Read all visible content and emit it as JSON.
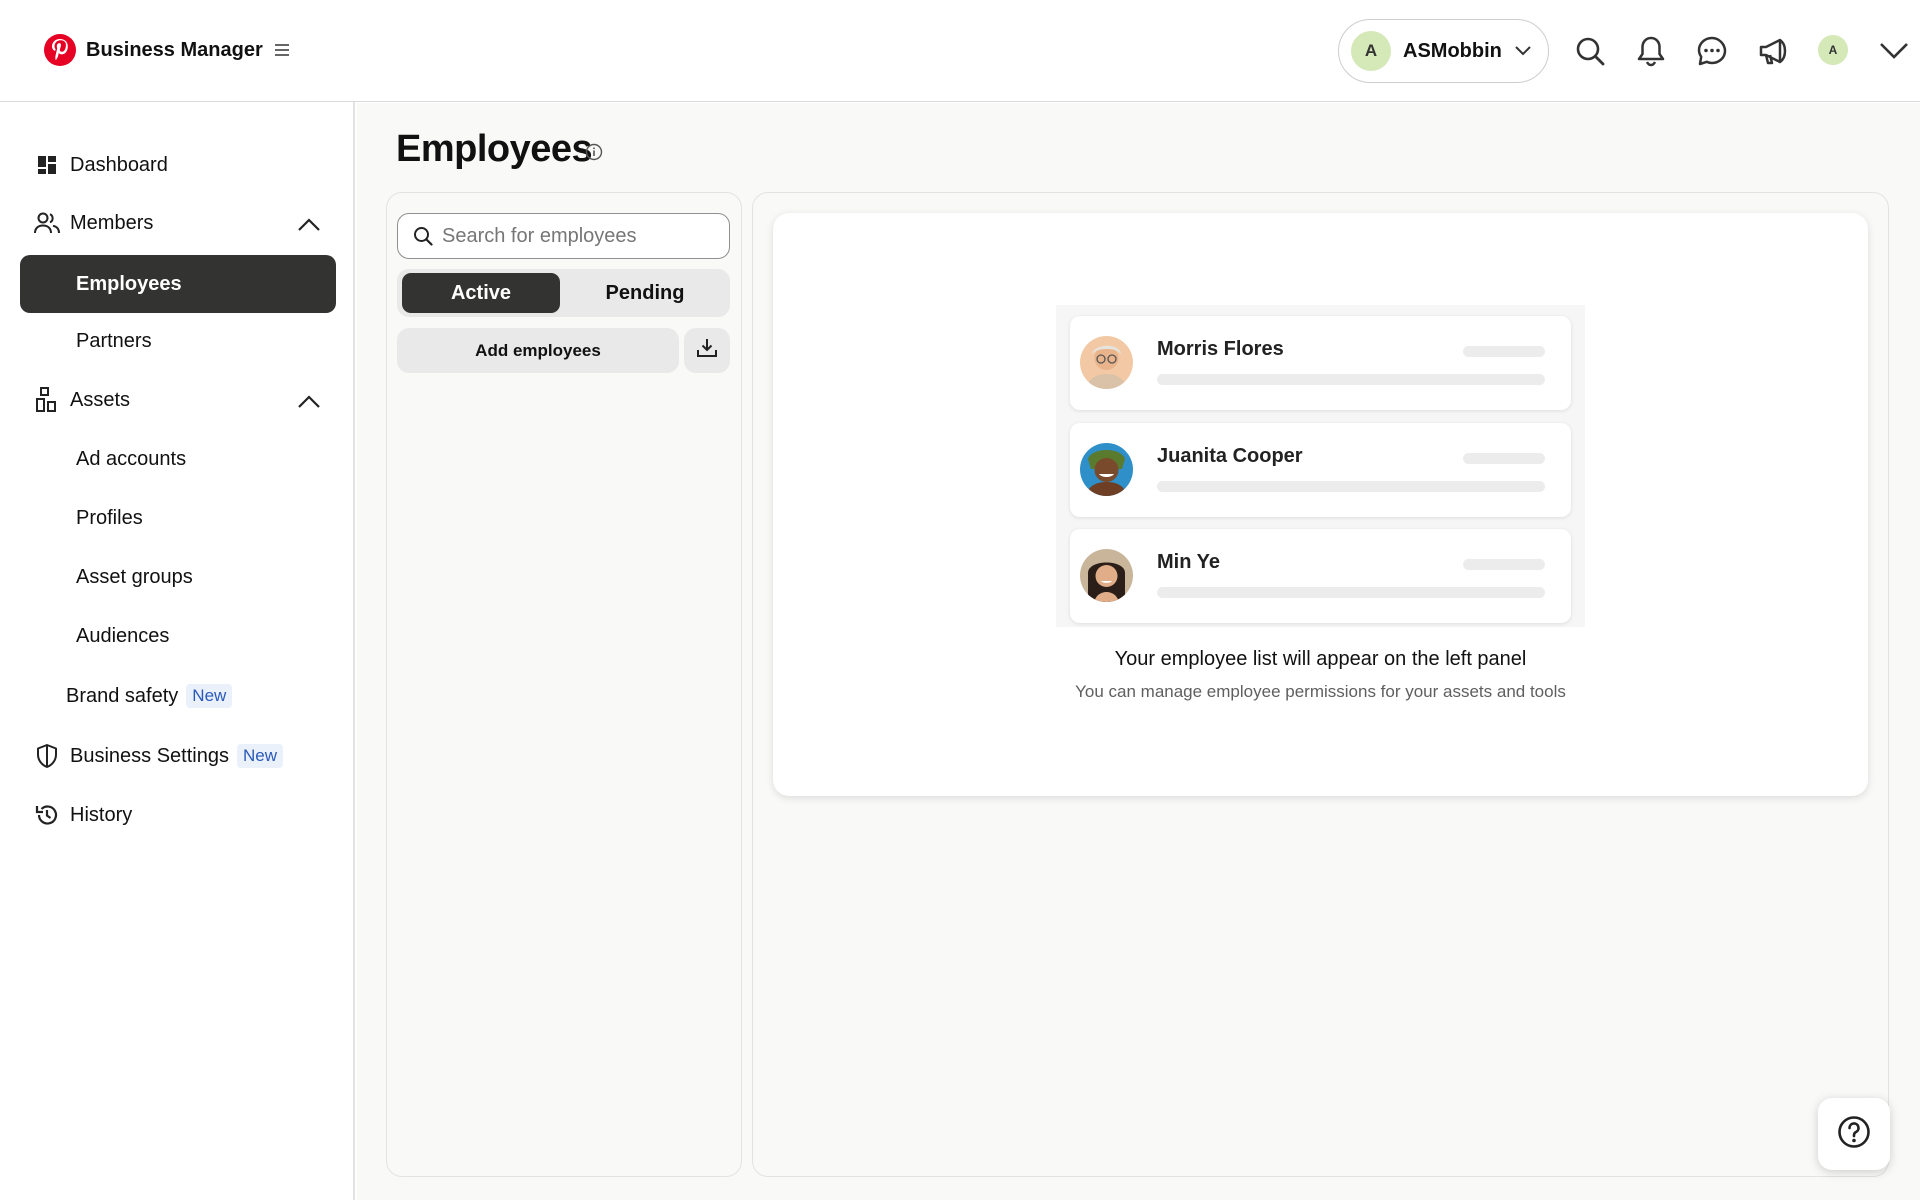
{
  "header": {
    "app_title": "Business Manager",
    "account_initial": "A",
    "account_name": "ASMobbin",
    "user_initial": "A"
  },
  "sidebar": {
    "items": [
      {
        "label": "Dashboard",
        "icon": "dashboard-icon"
      },
      {
        "label": "Members",
        "icon": "members-icon",
        "expanded": true
      },
      {
        "label": "Employees",
        "active": true
      },
      {
        "label": "Partners"
      },
      {
        "label": "Assets",
        "icon": "assets-icon",
        "expanded": true
      },
      {
        "label": "Ad accounts"
      },
      {
        "label": "Profiles"
      },
      {
        "label": "Asset groups"
      },
      {
        "label": "Audiences"
      },
      {
        "label": "Brand safety",
        "badge": "New"
      },
      {
        "label": "Business Settings",
        "icon": "shield-icon",
        "badge": "New"
      },
      {
        "label": "History",
        "icon": "history-icon"
      }
    ]
  },
  "main": {
    "page_title": "Employees",
    "search_placeholder": "Search for employees",
    "tabs": [
      "Active",
      "Pending"
    ],
    "active_tab": "Active",
    "add_button": "Add employees",
    "illustration_names": [
      "Morris Flores",
      "Juanita Cooper",
      "Min Ye"
    ],
    "empty_title": "Your employee list will appear on the left panel",
    "empty_subtitle": "You can manage employee permissions for your assets and tools"
  },
  "colors": {
    "brand_red": "#e60023",
    "active_dark": "#333331",
    "badge_bg": "#eaf1fb",
    "badge_text": "#2a59b8",
    "avatar_green": "#d4e8b8"
  }
}
